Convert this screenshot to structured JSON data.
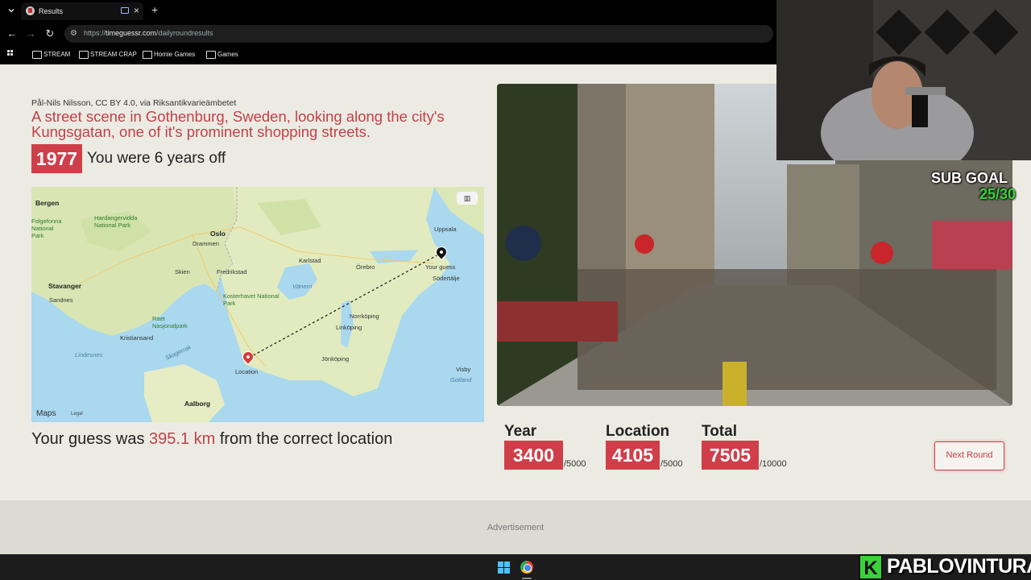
{
  "browser": {
    "tab_title": "Results",
    "url_host": "timeguessr.com",
    "url_prefix": "https://",
    "url_path": "/dailyroundresults",
    "bookmarks": [
      "STREAM",
      "STREAM CRAP",
      "Homie Games",
      "Games"
    ]
  },
  "result": {
    "credit": "Pål-Nils Nilsson, CC BY 4.0, via Riksantikvarieämbetet",
    "description": "A street scene in Gothenburg, Sweden, looking along the city's Kungsgatan, one of it's prominent shopping streets.",
    "year": "1977",
    "years_off_text": "You were 6 years off",
    "distance_prefix": "Your guess was ",
    "distance_value": "395.1 km",
    "distance_suffix": " from the correct location"
  },
  "map": {
    "labels": {
      "bergen": "Bergen",
      "oslo": "Oslo",
      "drammen": "Drammen",
      "uppsala": "Uppsala",
      "hardangervidda": "Hardangervidda National Park",
      "folgefonna": "Folgefonna National Park",
      "karlstad": "Karlstad",
      "orebro": "Örebro",
      "skien": "Skien",
      "fredrikstad": "Fredrikstad",
      "stavanger": "Stavanger",
      "sandnes": "Sandnes",
      "kosterhavet": "Kosterhavet National Park",
      "raet": "Raet Nasjonalpark",
      "kristiansand": "Kristiansand",
      "lindesnes": "Lindesnes",
      "skagerrak": "Skagerrak",
      "vanern": "Vänern",
      "norrkoping": "Norrköping",
      "linkoping": "Linköping",
      "sodertalje": "Södertälje",
      "your_guess": "Your guess",
      "location": "Location",
      "jonkoping": "Jönköping",
      "gotland": "Gotland",
      "visby": "Visby",
      "aalborg": "Aalborg"
    },
    "brand": "Maps",
    "legal": "Legal"
  },
  "scores": {
    "year": {
      "label": "Year",
      "value": "3400",
      "max": "/5000"
    },
    "location": {
      "label": "Location",
      "value": "4105",
      "max": "/5000"
    },
    "total": {
      "label": "Total",
      "value": "7505",
      "max": "/10000"
    }
  },
  "next_button": "Next Round",
  "advertisement": "Advertisement",
  "overlay": {
    "sub_goal_label": "SUB GOAL",
    "sub_goal_count": "25/30",
    "brand_letter": "K",
    "brand_name": "PABLOVINTURA"
  },
  "colors": {
    "accent_red": "#cf3f4a",
    "page_bg": "#ecebe3",
    "sub_green": "#3ad13a"
  }
}
